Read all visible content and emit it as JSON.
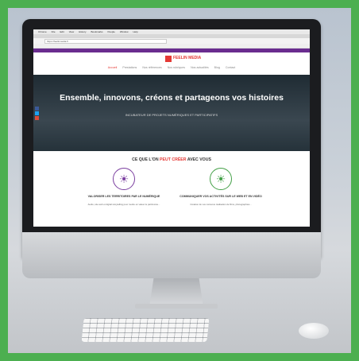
{
  "browser": {
    "menu_items": [
      "Chrome",
      "File",
      "Edit",
      "View",
      "History",
      "Bookmarks",
      "People",
      "Window",
      "Help"
    ],
    "url": "https://feelinmedia.fr"
  },
  "site": {
    "logo_text": "FEELIN MEDIA",
    "nav": [
      "Accueil",
      "Prestations",
      "Nos références",
      "Nos rubriques",
      "Nos actualités",
      "Blog",
      "Contact"
    ]
  },
  "hero": {
    "title": "Ensemble, innovons, créons et partageons vos histoires",
    "subtitle": "INCUBATEUR DE PROJETS NUMÉRIQUES ET PARTICIPATIFS"
  },
  "section": {
    "title_prefix": "CE QUE L'ON ",
    "title_accent": "PEUT CRÉER",
    "title_suffix": " AVEC VOUS",
    "accent_color": "#e53935"
  },
  "columns": [
    {
      "heading": "VALORISER LES TERRITOIRES PAR LE NUMÉRIQUE",
      "text": "Audio, site web et digital storytelling pour mettre en valeur le patrimoine...",
      "icon": "lightbulb-icon",
      "color": "#7b3fa0"
    },
    {
      "heading": "COMMUNIQUER VOS ACTIVITÉS SUR LE WEB ET EN VIDÉO",
      "text": "Création de vos contenus réalisation de films, photographies...",
      "icon": "lightbulb-icon",
      "color": "#43a047"
    }
  ],
  "colors": {
    "frame": "#4caf50",
    "topstrip": "#6a2c8f"
  }
}
